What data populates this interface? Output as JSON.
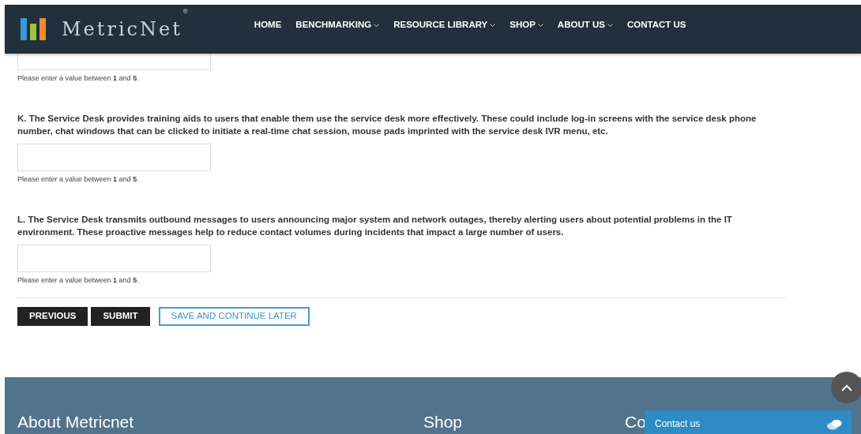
{
  "header": {
    "logo": {
      "text": "MetricNet",
      "mark": "®"
    },
    "nav": [
      {
        "label": "HOME",
        "has_menu": false
      },
      {
        "label": "BENCHMARKING",
        "has_menu": true
      },
      {
        "label": "RESOURCE LIBRARY",
        "has_menu": true
      },
      {
        "label": "SHOP",
        "has_menu": true
      },
      {
        "label": "ABOUT US",
        "has_menu": true
      },
      {
        "label": "CONTACT US",
        "has_menu": false
      }
    ]
  },
  "questions": [
    {
      "hint": "Please enter a value between **1** and **5**."
    },
    {
      "text": "K. The Service Desk provides training aids to users that enable them use the service desk more effectively. These could include log-in screens with the service desk phone number, chat windows that can be clicked to initiate a real-time chat session, mouse pads imprinted with the service desk IVR menu, etc.",
      "hint": "Please enter a value between **1** and **5**."
    },
    {
      "text": "L. The Service Desk transmits outbound messages to users announcing major system and network outages, thereby alerting users about potential problems in the IT environment. These proactive messages help to reduce contact volumes during incidents that impact a large number of users.",
      "hint": "Please enter a value between **1** and **5**."
    }
  ],
  "buttons": [
    {
      "label": "PREVIOUS",
      "kind": "dark"
    },
    {
      "label": "SUBMIT",
      "kind": "dark"
    },
    {
      "label": "SAVE AND CONTINUE LATER",
      "kind": "outline"
    }
  ],
  "footer": {
    "headings": [
      "About Metricnet",
      "Shop",
      "Co"
    ]
  },
  "contact_widget": {
    "label": "Contact us"
  }
}
